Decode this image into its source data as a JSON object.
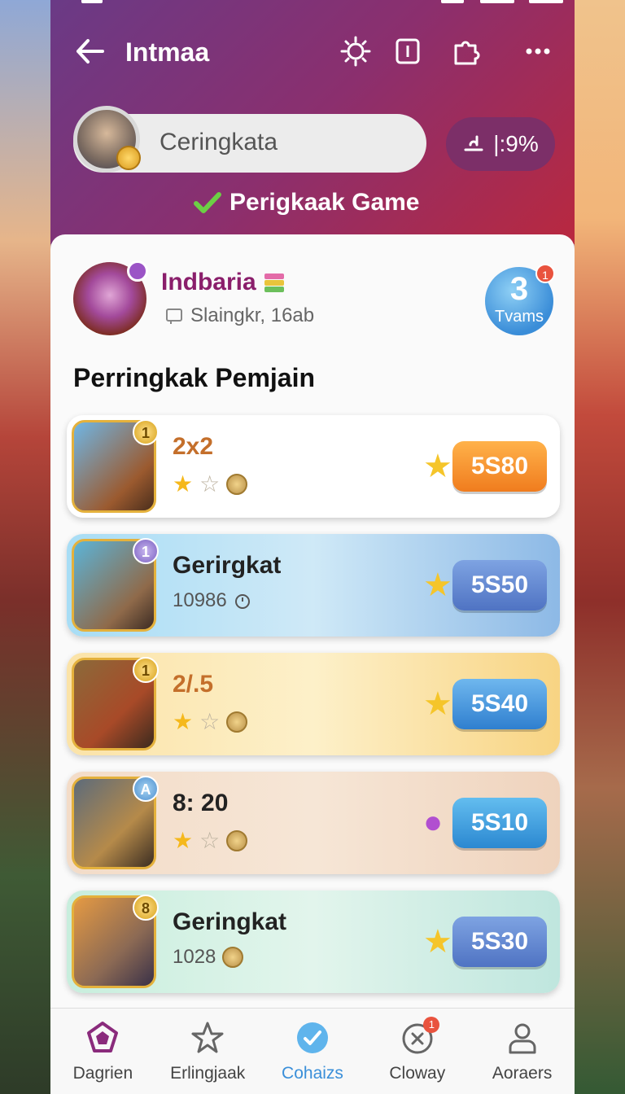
{
  "app": {
    "title": "Intmaa"
  },
  "search": {
    "placeholder": "Ceringkata"
  },
  "pill": {
    "value": "|:9%"
  },
  "subtitle": "Perigkaak Game",
  "profile": {
    "name": "Indbaria",
    "subtitle": "Slaingkr, 16ab"
  },
  "badge": {
    "number": "3",
    "label": "Tvams",
    "notification": "1"
  },
  "section_title": "Perringkak Pemjain",
  "players": [
    {
      "rank": "1",
      "label": "2x2",
      "meta": "",
      "stars": 1,
      "score": "5S80",
      "score_color": "#f2962c"
    },
    {
      "rank": "1",
      "label": "Gerirgkat",
      "meta": "10986",
      "stars": 0,
      "score": "5S50",
      "score_color": "#5f83cc"
    },
    {
      "rank": "1",
      "label": "2/.5",
      "meta": "",
      "stars": 1,
      "score": "5S40",
      "score_color": "#3e93d9"
    },
    {
      "rank": "A",
      "label": "8: 20",
      "meta": "",
      "stars": 1,
      "score": "5S10",
      "score_color": "#3a9ad8"
    },
    {
      "rank": "8",
      "label": "Geringkat",
      "meta": "1028",
      "stars": 0,
      "score": "5S30",
      "score_color": "#5f83cc"
    }
  ],
  "nav": [
    {
      "label": "Dagrien",
      "icon": "pentagon-icon"
    },
    {
      "label": "Erlingjaak",
      "icon": "star-icon"
    },
    {
      "label": "Cohaizs",
      "icon": "check-icon",
      "active": true
    },
    {
      "label": "Cloway",
      "icon": "clock-x-icon",
      "notification": "1"
    },
    {
      "label": "Aoraers",
      "icon": "user-icon"
    }
  ]
}
